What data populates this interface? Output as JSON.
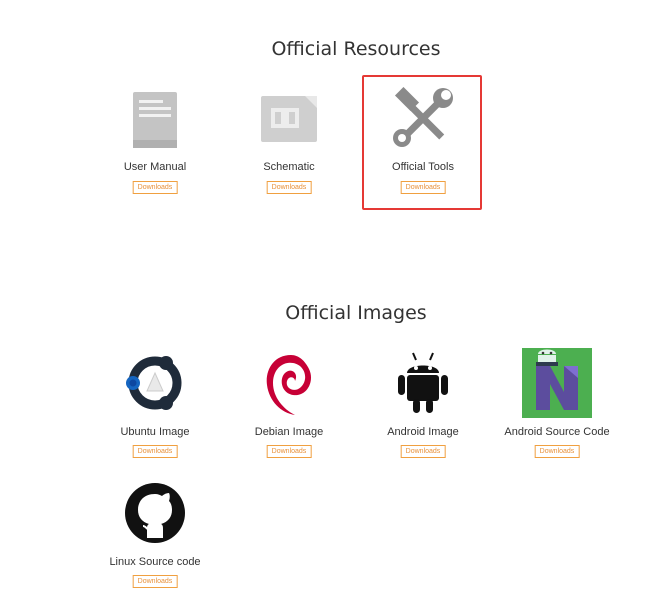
{
  "sections": {
    "resources_title": "Official Resources",
    "images_title": "Official Images"
  },
  "resources": [
    {
      "label": "User Manual",
      "button": "Downloads",
      "icon": "manual-book-icon"
    },
    {
      "label": "Schematic",
      "button": "Downloads",
      "icon": "chip-icon"
    },
    {
      "label": "Official Tools",
      "button": "Downloads",
      "icon": "wrench-hammer-icon",
      "highlighted": true
    }
  ],
  "images": [
    {
      "label": "Ubuntu Image",
      "button": "Downloads",
      "icon": "ubuntu-logo-icon"
    },
    {
      "label": "Debian Image",
      "button": "Downloads",
      "icon": "debian-logo-icon"
    },
    {
      "label": "Android Image",
      "button": "Downloads",
      "icon": "android-robot-icon"
    },
    {
      "label": "Android Source Code",
      "button": "Downloads",
      "icon": "android-nougat-icon"
    },
    {
      "label": "Linux Source code",
      "button": "Downloads",
      "icon": "github-logo-icon"
    }
  ],
  "colors": {
    "button_border": "#f0a040",
    "button_text": "#e8913a",
    "highlight_border": "#e53935"
  }
}
